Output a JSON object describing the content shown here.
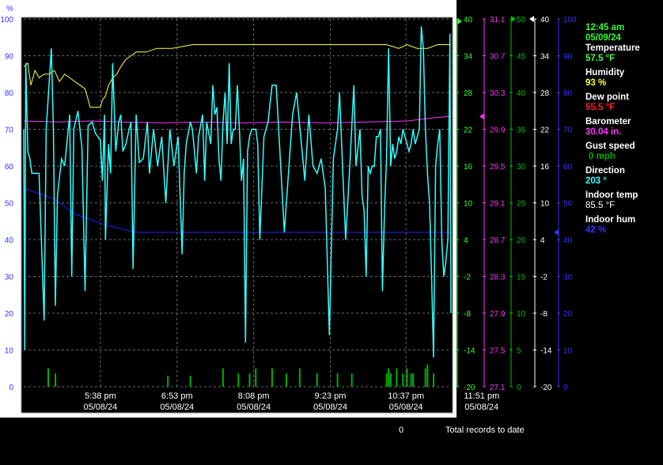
{
  "panel": {
    "time": "12:45 am",
    "date": "05/09/24",
    "temperature_label": "Temperature",
    "temperature_value": "57.5 °F",
    "humidity_label": "Humidity",
    "humidity_value": "93 %",
    "dewpoint_label": "Dew point",
    "dewpoint_value": "55.5 °F",
    "barometer_label": "Barometer",
    "barometer_value": "30.04 in.",
    "gust_label": "Gust speed",
    "gust_value": "0 mph",
    "direction_label": "Direction",
    "direction_value": "203 °",
    "indoor_temp_label": "Indoor temp",
    "indoor_temp_value": "85.5 °F",
    "indoor_hum_label": "Indoor hum",
    "indoor_hum_value": "42 %"
  },
  "footer": {
    "count": "0",
    "label": "Total records to date"
  },
  "colors": {
    "humidity": "#ffff44",
    "barometer": "#ff33ff",
    "temperature": "#44ff44",
    "direction": "#33ffff",
    "indoor_hum": "#2222ff",
    "gust": "#00b000",
    "dewpoint": "#ff2222",
    "indoor_temp": "#ffffff",
    "time_date": "#33ff33"
  },
  "chart_data": {
    "type": "line",
    "x_ticks": [
      {
        "time": "5:38 pm",
        "date": "05/08/24"
      },
      {
        "time": "6:53 pm",
        "date": "05/08/24"
      },
      {
        "time": "8:08 pm",
        "date": "05/08/24"
      },
      {
        "time": "9:23 pm",
        "date": "05/08/24"
      },
      {
        "time": "10:37 pm",
        "date": "05/08/24"
      },
      {
        "time": "11:51 pm",
        "date": "05/08/24"
      }
    ],
    "x_range_minutes": [
      -75,
      343
    ],
    "axes": [
      {
        "id": "pct",
        "unit_label": "%",
        "color": "#3333ff",
        "min": 0,
        "max": 100,
        "ticks": [
          "0",
          "10",
          "20",
          "30",
          "40",
          "50",
          "60",
          "70",
          "80",
          "90",
          "100"
        ]
      },
      {
        "id": "temp",
        "color": "#33ff33",
        "min": -20,
        "max": 40,
        "ticks": [
          "-20",
          "-14",
          "-8",
          "-2",
          "4",
          "10",
          "16",
          "22",
          "28",
          "34",
          "40"
        ]
      },
      {
        "id": "baro",
        "color": "#ff33ff",
        "min": 27.1,
        "max": 31.1,
        "ticks": [
          "27.1",
          "27.5",
          "27.9",
          "28.3",
          "28.7",
          "29.1",
          "29.5",
          "29.9",
          "30.3",
          "30.7",
          "31.1"
        ]
      },
      {
        "id": "gust",
        "color": "#00c000",
        "min": 0,
        "max": 50,
        "ticks": [
          "0",
          "5",
          "10",
          "15",
          "20",
          "25",
          "30",
          "35",
          "40",
          "45",
          "50"
        ]
      },
      {
        "id": "itemp",
        "color": "#ffffff",
        "min": -20,
        "max": 40,
        "ticks": [
          "-20",
          "-14",
          "-8",
          "-2",
          "4",
          "10",
          "16",
          "22",
          "28",
          "34",
          "40"
        ]
      },
      {
        "id": "ihum",
        "color": "#3333ff",
        "min": 0,
        "max": 100,
        "ticks": [
          "0",
          "10",
          "20",
          "30",
          "40",
          "50",
          "60",
          "70",
          "80",
          "90",
          "100"
        ]
      }
    ],
    "series": [
      {
        "key": "humidity",
        "axis": "pct",
        "color": "#ffff44",
        "points": [
          [
            -75,
            87
          ],
          [
            -71,
            88
          ],
          [
            -68,
            82
          ],
          [
            -64,
            86
          ],
          [
            -60,
            84
          ],
          [
            -55,
            85
          ],
          [
            -50,
            85
          ],
          [
            -45,
            86
          ],
          [
            -40,
            83
          ],
          [
            -35,
            85
          ],
          [
            -30,
            84
          ],
          [
            -25,
            83
          ],
          [
            -20,
            82
          ],
          [
            -15,
            81
          ],
          [
            -12,
            78
          ],
          [
            -10,
            76
          ],
          [
            -5,
            76
          ],
          [
            0,
            76
          ],
          [
            2,
            78
          ],
          [
            5,
            79
          ],
          [
            8,
            82
          ],
          [
            12,
            84
          ],
          [
            16,
            85
          ],
          [
            20,
            87
          ],
          [
            25,
            89
          ],
          [
            30,
            90
          ],
          [
            35,
            91
          ],
          [
            45,
            91
          ],
          [
            55,
            92
          ],
          [
            70,
            92
          ],
          [
            90,
            93
          ],
          [
            120,
            93
          ],
          [
            160,
            93
          ],
          [
            200,
            93
          ],
          [
            240,
            93
          ],
          [
            280,
            93
          ],
          [
            292,
            92
          ],
          [
            300,
            93
          ],
          [
            310,
            92
          ],
          [
            320,
            92
          ],
          [
            330,
            93
          ],
          [
            343,
            93
          ]
        ]
      },
      {
        "key": "barometer",
        "axis": "baro",
        "points": [
          [
            -75,
            29.99
          ],
          [
            -40,
            29.98
          ],
          [
            -10,
            29.99
          ],
          [
            20,
            29.98
          ],
          [
            60,
            29.97
          ],
          [
            100,
            29.98
          ],
          [
            140,
            29.97
          ],
          [
            180,
            29.98
          ],
          [
            220,
            29.97
          ],
          [
            260,
            29.98
          ],
          [
            300,
            29.99
          ],
          [
            330,
            30.03
          ],
          [
            343,
            30.04
          ]
        ]
      },
      {
        "key": "indoor_hum",
        "axis": "ihum",
        "points": [
          [
            -75,
            54
          ],
          [
            -65,
            53
          ],
          [
            -55,
            52
          ],
          [
            -45,
            51
          ],
          [
            -35,
            49
          ],
          [
            -25,
            47
          ],
          [
            -15,
            46
          ],
          [
            -5,
            45
          ],
          [
            5,
            44
          ],
          [
            20,
            43
          ],
          [
            35,
            42
          ],
          [
            60,
            42
          ],
          [
            100,
            42
          ],
          [
            140,
            42
          ],
          [
            180,
            42
          ],
          [
            220,
            42
          ],
          [
            260,
            42
          ],
          [
            300,
            42
          ],
          [
            320,
            42
          ],
          [
            343,
            42
          ]
        ]
      },
      {
        "key": "direction",
        "axis": "pct",
        "points": [
          [
            -75,
            70
          ],
          [
            -74,
            10
          ],
          [
            -73,
            88
          ],
          [
            -71,
            64
          ],
          [
            -69,
            62
          ],
          [
            -67,
            58
          ],
          [
            -60,
            58
          ],
          [
            -55,
            18
          ],
          [
            -53,
            70
          ],
          [
            -48,
            92
          ],
          [
            -46,
            70
          ],
          [
            -44,
            22
          ],
          [
            -42,
            52
          ],
          [
            -38,
            62
          ],
          [
            -35,
            60
          ],
          [
            -30,
            74
          ],
          [
            -28,
            30
          ],
          [
            -26,
            70
          ],
          [
            -22,
            75
          ],
          [
            -18,
            65
          ],
          [
            -15,
            26
          ],
          [
            -12,
            71
          ],
          [
            -8,
            72
          ],
          [
            -5,
            69
          ],
          [
            0,
            67
          ],
          [
            2,
            56
          ],
          [
            4,
            74
          ],
          [
            5,
            40
          ],
          [
            8,
            66
          ],
          [
            10,
            58
          ],
          [
            12,
            88
          ],
          [
            15,
            64
          ],
          [
            18,
            72
          ],
          [
            20,
            74
          ],
          [
            22,
            64
          ],
          [
            25,
            66
          ],
          [
            28,
            70
          ],
          [
            30,
            72
          ],
          [
            32,
            32
          ],
          [
            35,
            74
          ],
          [
            38,
            61
          ],
          [
            42,
            62
          ],
          [
            46,
            72
          ],
          [
            48,
            58
          ],
          [
            52,
            70
          ],
          [
            56,
            60
          ],
          [
            60,
            68
          ],
          [
            64,
            50
          ],
          [
            68,
            70
          ],
          [
            72,
            60
          ],
          [
            76,
            68
          ],
          [
            80,
            36
          ],
          [
            82,
            58
          ],
          [
            84,
            66
          ],
          [
            88,
            72
          ],
          [
            90,
            70
          ],
          [
            94,
            58
          ],
          [
            96,
            68
          ],
          [
            100,
            74
          ],
          [
            102,
            56
          ],
          [
            104,
            72
          ],
          [
            108,
            66
          ],
          [
            110,
            82
          ],
          [
            112,
            74
          ],
          [
            114,
            76
          ],
          [
            116,
            62
          ],
          [
            118,
            56
          ],
          [
            120,
            72
          ],
          [
            122,
            80
          ],
          [
            124,
            66
          ],
          [
            126,
            88
          ],
          [
            128,
            66
          ],
          [
            130,
            70
          ],
          [
            132,
            70
          ],
          [
            134,
            82
          ],
          [
            136,
            70
          ],
          [
            138,
            56
          ],
          [
            140,
            62
          ],
          [
            142,
            12
          ],
          [
            144,
            64
          ],
          [
            146,
            68
          ],
          [
            148,
            70
          ],
          [
            152,
            70
          ],
          [
            154,
            66
          ],
          [
            156,
            40
          ],
          [
            160,
            68
          ],
          [
            164,
            72
          ],
          [
            168,
            82
          ],
          [
            172,
            82
          ],
          [
            176,
            62
          ],
          [
            180,
            42
          ],
          [
            184,
            58
          ],
          [
            188,
            74
          ],
          [
            192,
            80
          ],
          [
            196,
            68
          ],
          [
            200,
            56
          ],
          [
            204,
            74
          ],
          [
            208,
            60
          ],
          [
            212,
            58
          ],
          [
            216,
            62
          ],
          [
            220,
            54
          ],
          [
            224,
            14
          ],
          [
            228,
            62
          ],
          [
            232,
            70
          ],
          [
            234,
            80
          ],
          [
            236,
            66
          ],
          [
            240,
            40
          ],
          [
            244,
            60
          ],
          [
            248,
            82
          ],
          [
            250,
            60
          ],
          [
            254,
            70
          ],
          [
            256,
            52
          ],
          [
            258,
            48
          ],
          [
            260,
            30
          ],
          [
            262,
            60
          ],
          [
            264,
            58
          ],
          [
            266,
            60
          ],
          [
            268,
            60
          ],
          [
            270,
            68
          ],
          [
            272,
            68
          ],
          [
            274,
            70
          ],
          [
            276,
            26
          ],
          [
            278,
            48
          ],
          [
            280,
            62
          ],
          [
            282,
            92
          ],
          [
            284,
            60
          ],
          [
            286,
            66
          ],
          [
            288,
            62
          ],
          [
            290,
            64
          ],
          [
            292,
            68
          ],
          [
            294,
            66
          ],
          [
            296,
            70
          ],
          [
            298,
            68
          ],
          [
            300,
            66
          ],
          [
            302,
            64
          ],
          [
            304,
            66
          ],
          [
            306,
            70
          ],
          [
            308,
            66
          ],
          [
            310,
            68
          ],
          [
            312,
            70
          ],
          [
            314,
            98
          ],
          [
            316,
            92
          ],
          [
            318,
            70
          ],
          [
            320,
            58
          ],
          [
            322,
            50
          ],
          [
            324,
            30
          ],
          [
            326,
            8
          ],
          [
            328,
            60
          ],
          [
            330,
            66
          ],
          [
            332,
            70
          ],
          [
            334,
            40
          ],
          [
            336,
            30
          ],
          [
            338,
            34
          ],
          [
            340,
            40
          ],
          [
            342,
            96
          ],
          [
            343,
            20
          ]
        ]
      },
      {
        "key": "gust",
        "axis": "gust",
        "bars": [
          [
            -51,
            2.5
          ],
          [
            -44,
            1.8
          ],
          [
            66,
            1.5
          ],
          [
            88,
            1.5
          ],
          [
            120,
            2.5
          ],
          [
            135,
            1.8
          ],
          [
            146,
            1.8
          ],
          [
            152,
            2.5
          ],
          [
            168,
            2.5
          ],
          [
            182,
            1.8
          ],
          [
            195,
            2.5
          ],
          [
            212,
            1.8
          ],
          [
            232,
            1.8
          ],
          [
            246,
            1.8
          ],
          [
            280,
            1.8
          ],
          [
            282,
            2.5
          ],
          [
            284,
            1.8
          ],
          [
            290,
            2.5
          ],
          [
            296,
            1.8
          ],
          [
            300,
            2.5
          ],
          [
            304,
            1.8
          ],
          [
            306,
            1.8
          ],
          [
            318,
            2.5
          ],
          [
            320,
            3.0
          ],
          [
            326,
            1.8
          ]
        ]
      }
    ]
  }
}
